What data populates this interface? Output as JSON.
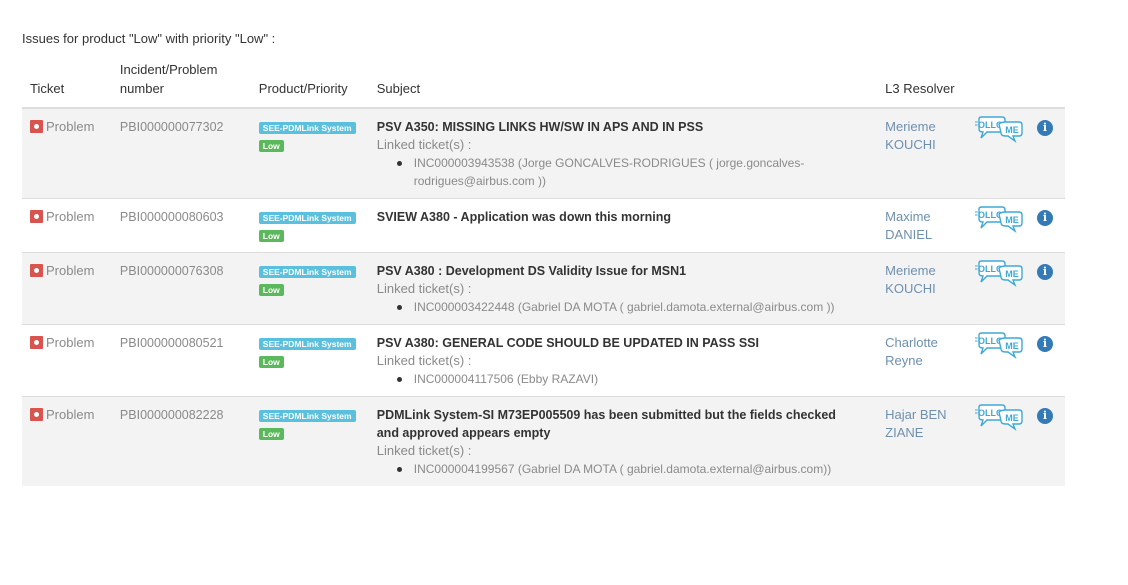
{
  "page": {
    "heading": "Issues for product \"Low\" with priority \"Low\" :"
  },
  "table": {
    "headers": {
      "ticket": "Ticket",
      "number_line1": "Incident/Problem",
      "number_line2": "number",
      "product_priority": "Product/Priority",
      "subject": "Subject",
      "resolver": "L3 Resolver"
    },
    "linked_label": "Linked ticket(s) :",
    "rows": [
      {
        "ticket": "Problem",
        "number": "PBI000000077302",
        "product": "SEE-PDMLink System",
        "priority": "Low",
        "subject_line1": "PSV A350: MISSING LINKS HW/SW IN APS AND IN PSS",
        "subject_line2": "",
        "linked_line1": "INC000003943538 (Jorge GONCALVES-RODRIGUES ( jorge.goncalves-",
        "linked_line2": "rodrigues@airbus.com ))",
        "resolver_first": "Merieme",
        "resolver_last": "KOUCHI"
      },
      {
        "ticket": "Problem",
        "number": "PBI000000080603",
        "product": "SEE-PDMLink System",
        "priority": "Low",
        "subject_line1": "SVIEW A380 - Application was down this morning",
        "subject_line2": "",
        "resolver_first": "Maxime",
        "resolver_last": "DANIEL"
      },
      {
        "ticket": "Problem",
        "number": "PBI000000076308",
        "product": "SEE-PDMLink System",
        "priority": "Low",
        "subject_line1": "PSV A380 : Development DS Validity Issue for MSN1",
        "subject_line2": "",
        "linked_line1": "INC000003422448 (Gabriel DA MOTA ( gabriel.damota.external@airbus.com ))",
        "linked_line2": "",
        "resolver_first": "Merieme",
        "resolver_last": "KOUCHI"
      },
      {
        "ticket": "Problem",
        "number": "PBI000000080521",
        "product": "SEE-PDMLink System",
        "priority": "Low",
        "subject_line1": "PSV A380: GENERAL CODE SHOULD BE UPDATED IN PASS SSI",
        "subject_line2": "",
        "linked_line1": "INC000004117506 (Ebby RAZAVI)",
        "linked_line2": "",
        "resolver_first": "Charlotte",
        "resolver_last": "Reyne"
      },
      {
        "ticket": "Problem",
        "number": "PBI000000082228",
        "product": "SEE-PDMLink System",
        "priority": "Low",
        "subject_line1": "PDMLink System-SI M73EP005509 has been submitted but the fields checked",
        "subject_line2": "and approved appears empty",
        "linked_line1": "INC000004199567 (Gabriel DA MOTA ( gabriel.damota.external@airbus.com))",
        "linked_line2": "",
        "resolver_first": "Hajar BEN",
        "resolver_last": "ZIANE"
      }
    ]
  },
  "icons": {
    "ticket_type": "problem-icon",
    "follow": "follow-me-icon",
    "info": "info-icon"
  },
  "colors": {
    "problem_red": "#d9534f",
    "product_badge": "#5bc0de",
    "priority_badge": "#5cb85c",
    "resolver_link": "#6f8fae",
    "info_blue": "#337ab7",
    "follow_blue": "#3fa9d6"
  }
}
